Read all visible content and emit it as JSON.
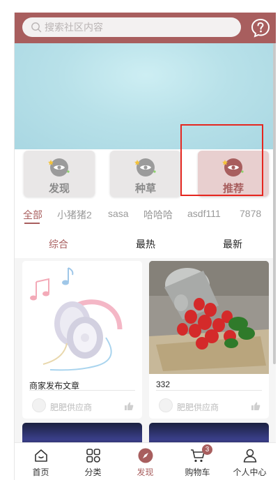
{
  "colors": {
    "accent": "#a85e5e",
    "highlight": "#e5261f",
    "header_bg": "#a85e5e"
  },
  "search": {
    "placeholder": "搜索社区内容",
    "icon": "search-icon"
  },
  "header": {
    "help_icon": "help-icon"
  },
  "categories": [
    {
      "label": "发现",
      "icon": "eye-icon",
      "active": false
    },
    {
      "label": "种草",
      "icon": "eye-icon",
      "active": false
    },
    {
      "label": "推荐",
      "icon": "eye-icon",
      "active": true
    }
  ],
  "tags": [
    "全部",
    "小猪猪2",
    "sasa",
    "哈哈哈",
    "asdf111",
    "7878"
  ],
  "sorts": [
    "综合",
    "最热",
    "最新"
  ],
  "posts": [
    {
      "title": "商家发布文章",
      "author": "肥肥供应商",
      "image": "headphones"
    },
    {
      "title": "332",
      "author": "肥肥供应商",
      "image": "strawberries"
    }
  ],
  "tabbar": [
    {
      "label": "首页",
      "icon": "home-icon"
    },
    {
      "label": "分类",
      "icon": "grid-icon"
    },
    {
      "label": "发现",
      "icon": "compass-icon",
      "active": true
    },
    {
      "label": "购物车",
      "icon": "cart-icon",
      "badge": "3"
    },
    {
      "label": "个人中心",
      "icon": "user-icon"
    }
  ]
}
